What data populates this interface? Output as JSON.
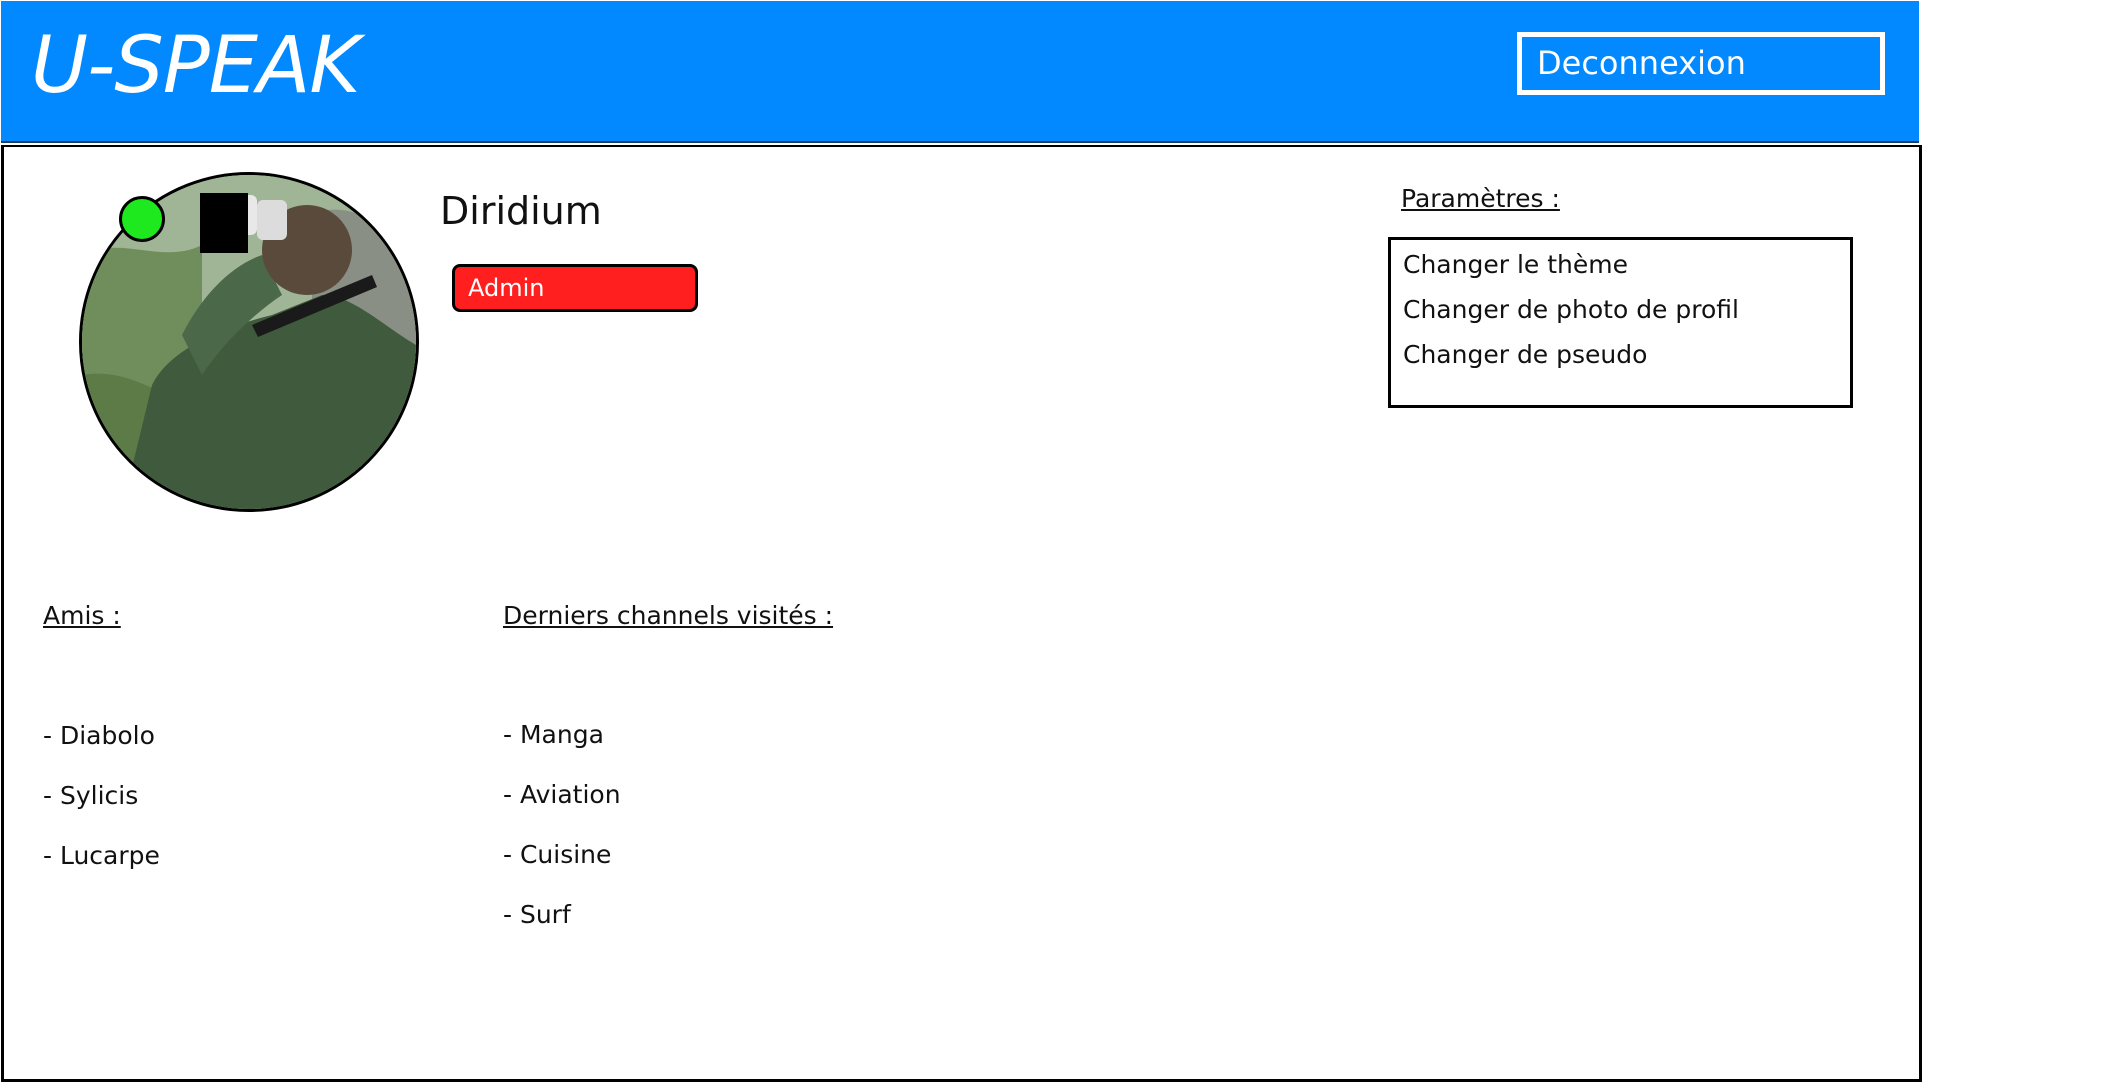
{
  "header": {
    "logo": "U-SPEAK",
    "logout_label": "Deconnexion",
    "colors": {
      "background": "#0288ff",
      "text": "#ffffff"
    }
  },
  "profile": {
    "username": "Diridium",
    "role": "Admin",
    "status_color": "#1ee81e",
    "role_color": "#ff1f1f"
  },
  "settings": {
    "title": "Paramètres :",
    "items": [
      {
        "label": "Changer le thème"
      },
      {
        "label": "Changer de photo de profil"
      },
      {
        "label": "Changer de pseudo"
      }
    ]
  },
  "friends": {
    "title": "Amis :",
    "items": [
      "- Diabolo",
      "- Sylicis",
      "- Lucarpe"
    ]
  },
  "channels": {
    "title": "Derniers channels visités :",
    "items": [
      "- Manga",
      "- Aviation",
      "- Cuisine",
      "- Surf"
    ]
  }
}
